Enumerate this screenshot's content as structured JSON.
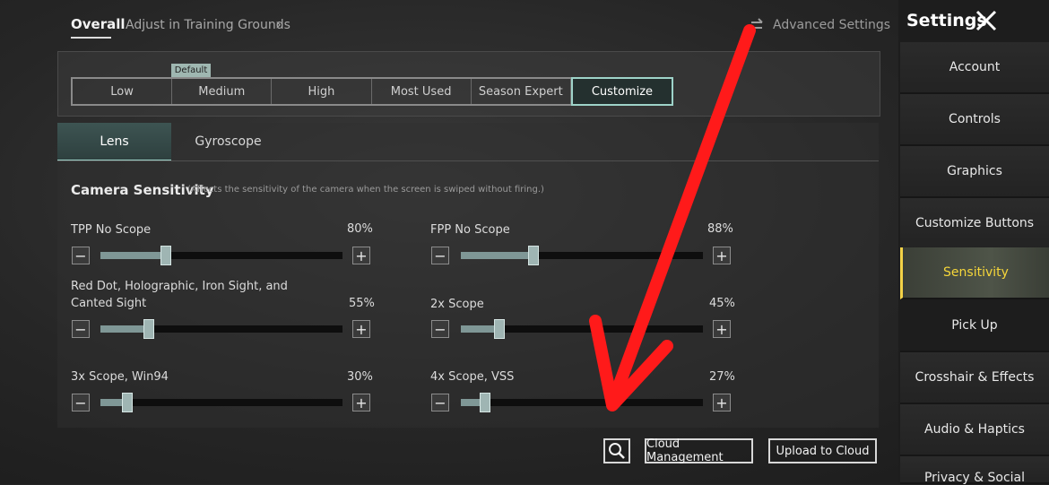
{
  "topbar": {
    "overall_label": "Overall",
    "crumb_label": "Adjust in Training Grounds",
    "advanced_label": "Advanced Settings"
  },
  "sidebar": {
    "title": "Settings",
    "items": [
      {
        "label": "Account",
        "active": false
      },
      {
        "label": "Controls",
        "active": false
      },
      {
        "label": "Graphics",
        "active": false
      },
      {
        "label": "Customize Buttons",
        "active": false
      },
      {
        "label": "Sensitivity",
        "active": true
      },
      {
        "label": "Pick Up",
        "active": false
      },
      {
        "label": "Crosshair & Effects",
        "active": false
      },
      {
        "label": "Audio & Haptics",
        "active": false
      },
      {
        "label": "Privacy & Social",
        "active": false
      }
    ]
  },
  "presets": {
    "default_tag": "Default",
    "items": [
      "Low",
      "Medium",
      "High",
      "Most Used",
      "Season Expert",
      "Customize"
    ],
    "selected": "Customize"
  },
  "tabs": {
    "lens": "Lens",
    "gyroscope": "Gyroscope"
  },
  "camera": {
    "title": "Camera Sensitivity",
    "note": "(Affects the sensitivity of the camera when the screen is swiped without firing.)"
  },
  "sliders": [
    {
      "label": "TPP No Scope",
      "value": "80%",
      "level": 0.27
    },
    {
      "label": "FPP No Scope",
      "value": "88%",
      "level": 0.3
    },
    {
      "label": "Red Dot, Holographic, Iron Sight, and Canted Sight",
      "value": "55%",
      "level": 0.2
    },
    {
      "label": "2x Scope",
      "value": "45%",
      "level": 0.16
    },
    {
      "label": "3x Scope, Win94",
      "value": "30%",
      "level": 0.11
    },
    {
      "label": "4x Scope, VSS",
      "value": "27%",
      "level": 0.1
    }
  ],
  "buttons": {
    "cloud_management": "Cloud Management",
    "upload_to_cloud": "Upload to Cloud",
    "minus": "−",
    "plus": "+"
  },
  "colors": {
    "accent": "#9ed3c9",
    "active_sidebar_text": "#f5d63a",
    "annotation_arrow": "#ff1a1a"
  }
}
